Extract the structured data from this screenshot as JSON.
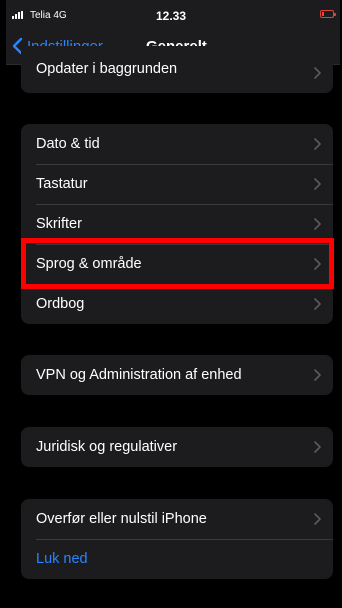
{
  "status_bar": {
    "carrier": "Telia  4G",
    "time": "12.33",
    "signal_icon": "signal-bars-icon",
    "battery_icon": "battery-low-icon",
    "battery_color": "#ff3b30"
  },
  "nav": {
    "back_label": "Indstillinger",
    "title": "Generelt"
  },
  "groups": [
    {
      "items": [
        {
          "label": "Opdater i baggrunden"
        }
      ]
    },
    {
      "items": [
        {
          "label": "Dato & tid"
        },
        {
          "label": "Tastatur"
        },
        {
          "label": "Skrifter"
        },
        {
          "label": "Sprog & område"
        },
        {
          "label": "Ordbog"
        }
      ]
    },
    {
      "items": [
        {
          "label": "VPN og Administration af enhed"
        }
      ]
    },
    {
      "items": [
        {
          "label": "Juridisk og regulativer"
        }
      ]
    },
    {
      "items": [
        {
          "label": "Overfør eller nulstil iPhone"
        },
        {
          "label": "Luk ned"
        }
      ]
    }
  ],
  "highlight": {
    "target": "Sprog & område",
    "color": "#ff0000"
  },
  "colors": {
    "accent": "#2a84ff",
    "background": "#000000",
    "cell": "#1c1c1e"
  }
}
